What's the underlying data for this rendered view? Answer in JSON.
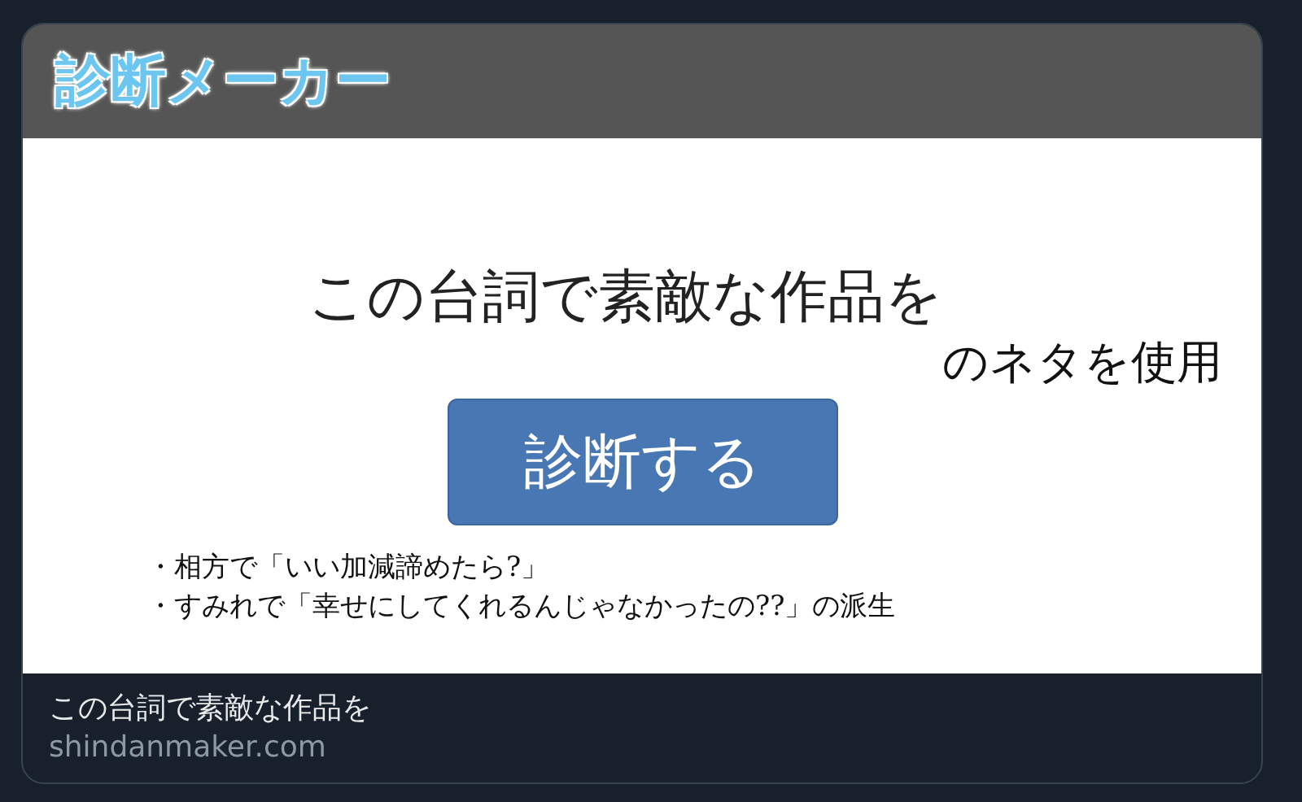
{
  "card": {
    "site_logo": "診断メーカー",
    "headline": "この台詞で素敵な作品を",
    "overlay_note": "のネタを使用",
    "button": "診断する",
    "notes": [
      "・相方で「いい加減諦めたら?」",
      "・すみれで「幸せにしてくれるんじゃなかったの??」の派生"
    ],
    "link_title": "この台詞で素敵な作品を",
    "domain": "shindanmaker.com"
  }
}
